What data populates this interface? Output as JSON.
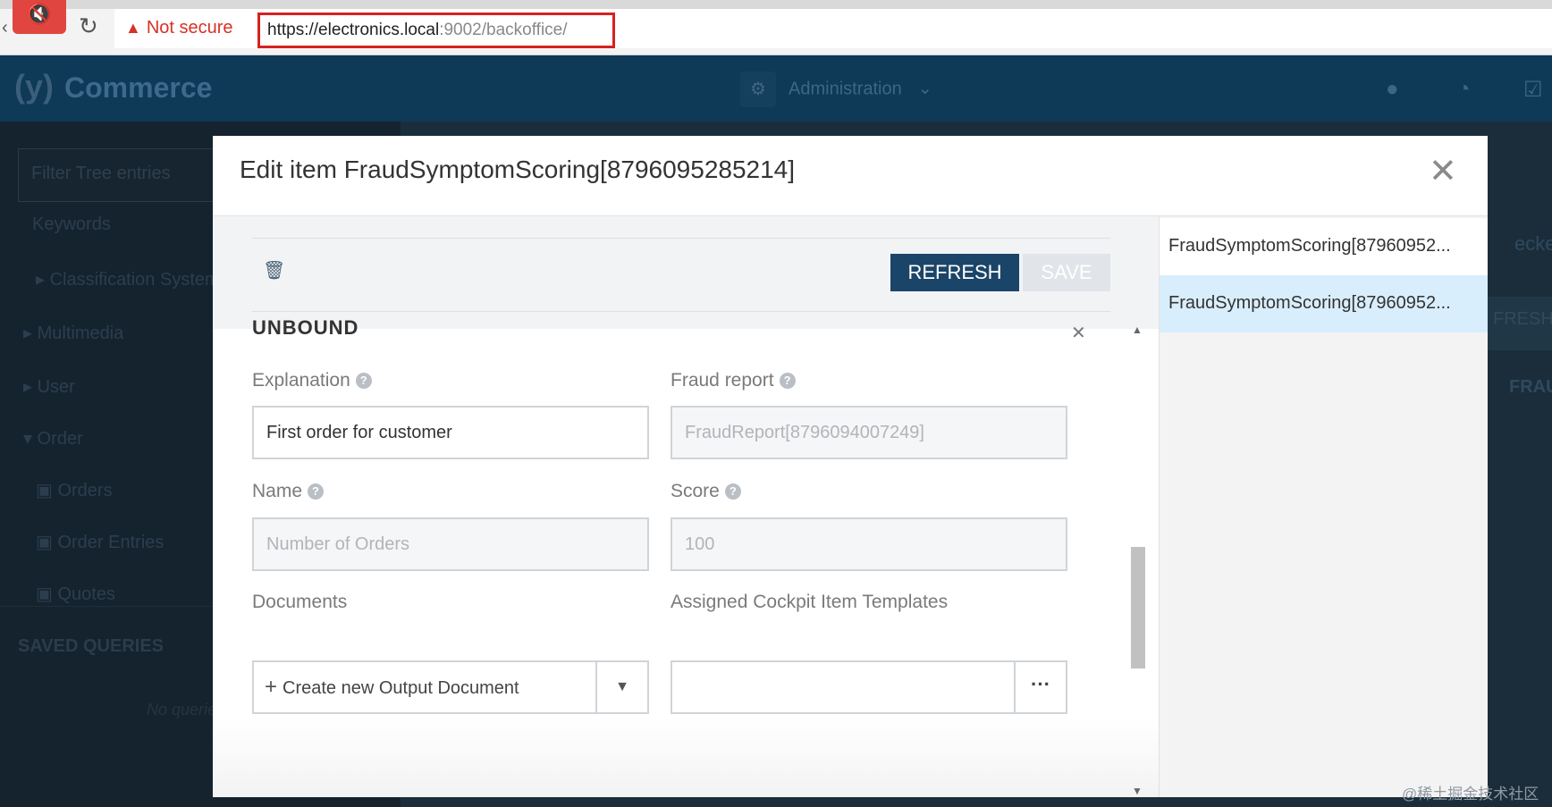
{
  "browser": {
    "security_label": "Not secure",
    "url_host": "https://electronics.local",
    "url_rest": ":9002/backoffice/"
  },
  "app": {
    "title": "Commerce",
    "perspective": "Administration"
  },
  "sidebar": {
    "filter_placeholder": "Filter Tree entries",
    "items": [
      {
        "label": "Keywords"
      },
      {
        "label": "Classification System"
      },
      {
        "label": "Multimedia"
      },
      {
        "label": "User"
      },
      {
        "label": "Order"
      },
      {
        "label": "Orders"
      },
      {
        "label": "Order Entries"
      },
      {
        "label": "Quotes"
      }
    ],
    "saved_queries_title": "SAVED QUERIES",
    "no_queries_text": "No queries"
  },
  "background": {
    "text_checked": "ecked",
    "text_refresh": "FRESH",
    "text_frau": "FRAU"
  },
  "modal": {
    "title": "Edit item FraudSymptomScoring[8796095285214]",
    "refresh_label": "REFRESH",
    "save_label": "SAVE",
    "section_title": "UNBOUND",
    "fields": {
      "explanation": {
        "label": "Explanation",
        "value": "First order for customer"
      },
      "fraud_report": {
        "label": "Fraud report",
        "value": "FraudReport[8796094007249]"
      },
      "name": {
        "label": "Name",
        "value": "Number of Orders"
      },
      "score": {
        "label": "Score",
        "value": "100"
      },
      "documents": {
        "label": "Documents",
        "create_label": "Create new Output Document"
      },
      "templates": {
        "label": "Assigned Cockpit Item Templates"
      }
    },
    "history": [
      {
        "label": "FraudSymptomScoring[87960952..."
      },
      {
        "label": "FraudSymptomScoring[87960952..."
      }
    ]
  },
  "watermark": "@稀土掘金技术社区",
  "colors": {
    "app_header": "#0e3957",
    "refresh_button": "#1b4568",
    "history_active": "#d9eefc",
    "url_highlight": "#d7211f"
  }
}
